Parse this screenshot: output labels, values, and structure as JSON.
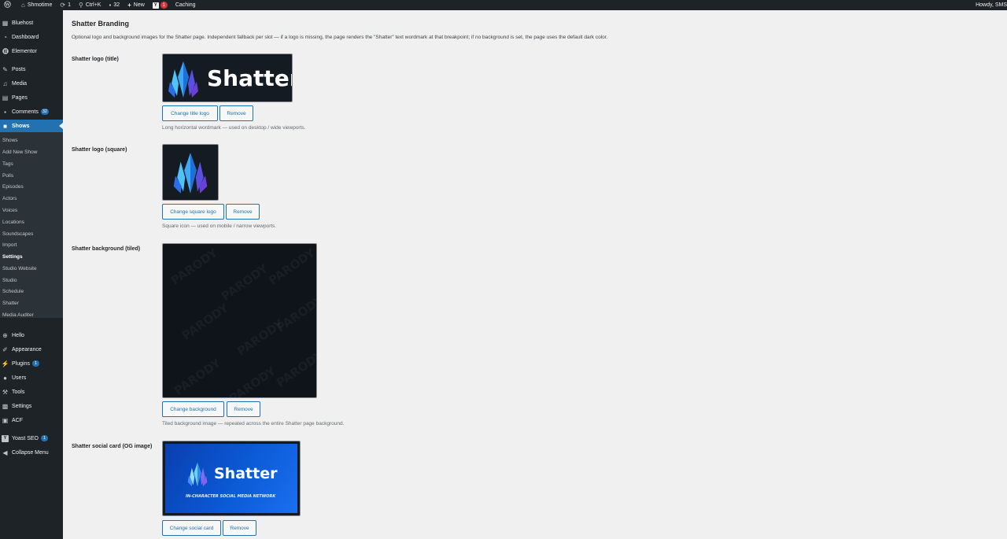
{
  "adminbar": {
    "site_name": "Shmotime",
    "updates_count": "1",
    "search_label": "Ctrl+K",
    "comments_count": "32",
    "new_label": "New",
    "yoast_badge": "1",
    "caching_label": "Caching",
    "howdy": "Howdy, SMS"
  },
  "sidebar": {
    "items": [
      {
        "label": "Bluehost",
        "icon": "grid-icon"
      },
      {
        "label": "Dashboard",
        "icon": "dashboard-icon"
      },
      {
        "label": "Elementor",
        "icon": "elementor-icon"
      },
      {
        "label": "Posts",
        "icon": "pin-icon"
      },
      {
        "label": "Media",
        "icon": "media-icon"
      },
      {
        "label": "Pages",
        "icon": "pages-icon"
      },
      {
        "label": "Comments",
        "icon": "comment-icon",
        "count": "32"
      },
      {
        "label": "Shows",
        "icon": "video-icon"
      },
      {
        "label": "Hello",
        "icon": "plus-circle-icon"
      },
      {
        "label": "Appearance",
        "icon": "brush-icon"
      },
      {
        "label": "Plugins",
        "icon": "plug-icon",
        "count": "1"
      },
      {
        "label": "Users",
        "icon": "user-icon"
      },
      {
        "label": "Tools",
        "icon": "wrench-icon"
      },
      {
        "label": "Settings",
        "icon": "settings-icon"
      },
      {
        "label": "ACF",
        "icon": "acf-icon"
      },
      {
        "label": "Yoast SEO",
        "icon": "yoast-icon",
        "count": "1"
      },
      {
        "label": "Collapse Menu",
        "icon": "collapse-icon"
      }
    ],
    "submenu": [
      "Shows",
      "Add New Show",
      "Tags",
      "Polls",
      "Episodes",
      "Actors",
      "Voices",
      "Locations",
      "Soundscapes",
      "Import",
      "Settings",
      "Studio Website",
      "Studio",
      "Schedule",
      "Shatter",
      "Media Auditer"
    ]
  },
  "main": {
    "title": "Shatter Branding",
    "description": "Optional logo and background images for the Shatter page. Independent fallback per slot — if a logo is missing, the page renders the \"Shatter\" text wordmark at that breakpoint; if no background is set, the page uses the default dark color.",
    "rows": [
      {
        "label": "Shatter logo (title)",
        "change": "Change title logo",
        "remove": "Remove",
        "help": "Long horizontal wordmark — used on desktop / wide viewports."
      },
      {
        "label": "Shatter logo (square)",
        "change": "Change square logo",
        "remove": "Remove",
        "help": "Square icon — used on mobile / narrow viewports."
      },
      {
        "label": "Shatter background (tiled)",
        "change": "Change background",
        "remove": "Remove",
        "help": "Tiled background image — repeated across the entire Shatter page background."
      },
      {
        "label": "Shatter social card (OG image)",
        "change": "Change social card",
        "remove": "Remove"
      }
    ],
    "logo_wordmark": "Shatter",
    "watermark_text": "PARODY",
    "social_tagline": "IN-CHARACTER SOCIAL MEDIA NETWORK"
  },
  "colors": {
    "adminbar_bg": "#1d2327",
    "sidebar_current": "#2271b1",
    "submenu_bg": "#2c3338",
    "page_bg": "#f0f0f1",
    "button_text": "#2271b1",
    "logo_bg": "#151b22",
    "social_blue": "#0b53c7"
  }
}
